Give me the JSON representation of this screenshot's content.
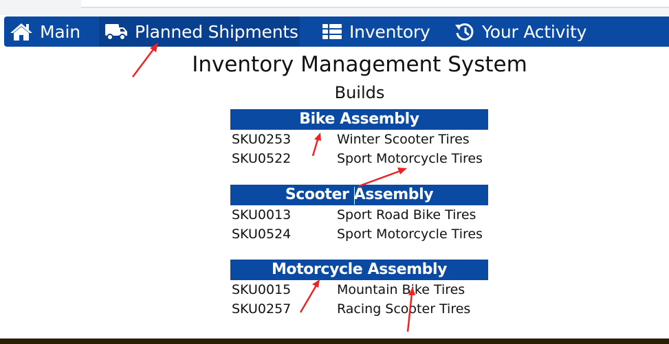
{
  "nav": {
    "items": [
      {
        "label": "Main",
        "icon": "home-icon"
      },
      {
        "label": "Planned Shipments",
        "icon": "truck-icon"
      },
      {
        "label": "Inventory",
        "icon": "table-list-icon"
      },
      {
        "label": "Your Activity",
        "icon": "history-icon"
      }
    ],
    "active": "Planned Shipments",
    "color": "#0b4aa2"
  },
  "page": {
    "title": "Inventory Management System",
    "subtitle": "Builds"
  },
  "builds": [
    {
      "name": "Bike Assembly",
      "parts": [
        {
          "sku": "SKU0253",
          "name": "Winter Scooter Tires"
        },
        {
          "sku": "SKU0522",
          "name": "Sport Motorcycle Tires"
        }
      ]
    },
    {
      "name": "Scooter Assembly",
      "parts": [
        {
          "sku": "SKU0013",
          "name": "Sport Road Bike Tires"
        },
        {
          "sku": "SKU0524",
          "name": "Sport Motorcycle Tires"
        }
      ]
    },
    {
      "name": "Motorcycle Assembly",
      "parts": [
        {
          "sku": "SKU0015",
          "name": "Mountain Bike Tires"
        },
        {
          "sku": "SKU0257",
          "name": "Racing Scooter Tires"
        }
      ]
    }
  ],
  "annotation_color": "#ee2222"
}
